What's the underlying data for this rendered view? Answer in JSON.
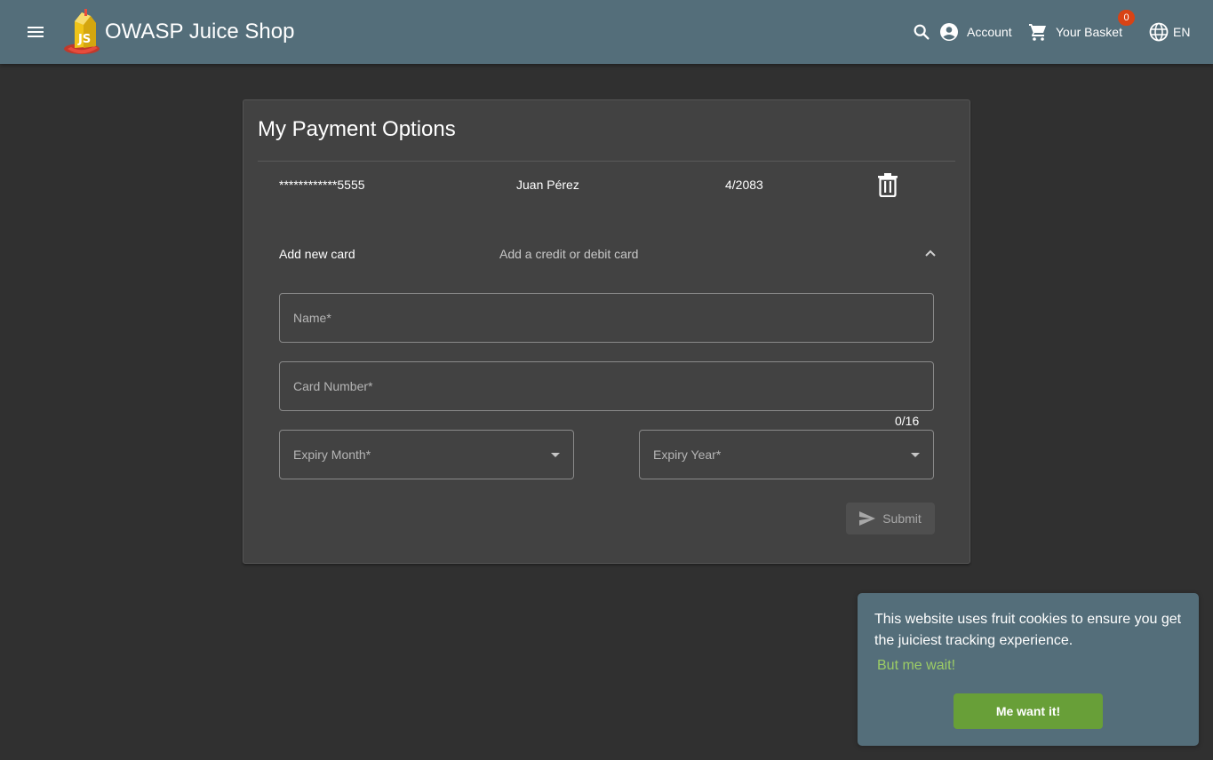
{
  "header": {
    "title": "OWASP Juice Shop",
    "menu_icon": "menu-icon",
    "search_icon": "search-icon",
    "account_label": "Account",
    "basket_label": "Your Basket",
    "basket_count": "0",
    "language_label": "EN"
  },
  "page": {
    "title": "My Payment Options"
  },
  "saved_cards": [
    {
      "number": "************5555",
      "name": "Juan Pérez",
      "expiry": "4/2083"
    }
  ],
  "add_card": {
    "title": "Add new card",
    "description": "Add a credit or debit card",
    "name_label": "Name*",
    "card_number_label": "Card Number*",
    "card_number_hint": "0/16",
    "expiry_month_label": "Expiry Month*",
    "expiry_year_label": "Expiry Year*",
    "submit_label": "Submit"
  },
  "cookie_banner": {
    "message": "This website uses fruit cookies to ensure you get the juiciest tracking experience.",
    "link_label": "But me wait!",
    "accept_label": "Me want it!"
  },
  "colors": {
    "toolbar": "#546e7a",
    "background": "#303030",
    "card": "#424242",
    "badge": "#d84315",
    "cookie_button": "#689f38",
    "cookie_link": "#9ccc65"
  }
}
